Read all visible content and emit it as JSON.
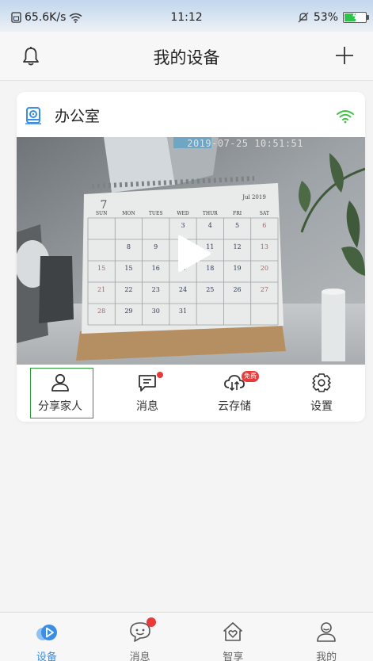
{
  "status_bar": {
    "speed": "65.6K/s",
    "time": "11:12",
    "battery": "53%",
    "battery_level": 0.53
  },
  "header": {
    "title": "我的设备",
    "left_icon": "bell-icon",
    "right_icon": "plus-icon"
  },
  "device": {
    "name": "办公室",
    "icon": "camera-icon",
    "signal": "wifi-icon",
    "timestamp": "2019-07-25 10:51:51",
    "calendar": {
      "number": "7",
      "month": "Jul 2019",
      "weekdays": [
        "SUN",
        "MON",
        "TUES",
        "WED",
        "THUR",
        "FRI",
        "SAT"
      ],
      "days": [
        [
          "",
          "",
          "",
          "3",
          "4",
          "5",
          "6"
        ],
        [
          "",
          "8",
          "9",
          "10",
          "11",
          "12",
          "13"
        ],
        [
          "15",
          "15",
          "16",
          "17",
          "18",
          "19",
          "20"
        ],
        [
          "21",
          "22",
          "23",
          "24",
          "25",
          "26",
          "27"
        ],
        [
          "28",
          "29",
          "30",
          "31",
          "",
          "",
          ""
        ]
      ]
    }
  },
  "actions": [
    {
      "label": "分享家人",
      "icon": "person-icon",
      "selected": true
    },
    {
      "label": "消息",
      "icon": "message-icon",
      "badge_dot": true
    },
    {
      "label": "云存储",
      "icon": "cloud-icon",
      "badge": "免费"
    },
    {
      "label": "设置",
      "icon": "gear-icon"
    }
  ],
  "tabs": [
    {
      "label": "设备",
      "icon": "device-tab-icon",
      "active": true
    },
    {
      "label": "消息",
      "icon": "message-tab-icon",
      "dot": true
    },
    {
      "label": "智享",
      "icon": "home-heart-icon"
    },
    {
      "label": "我的",
      "icon": "profile-icon"
    }
  ],
  "colors": {
    "accent": "#3a8ee6",
    "wifi": "#3cc341",
    "selected_frame": "#2a9a37",
    "badge": "#e83a3a",
    "battery": "#2dc44c"
  }
}
